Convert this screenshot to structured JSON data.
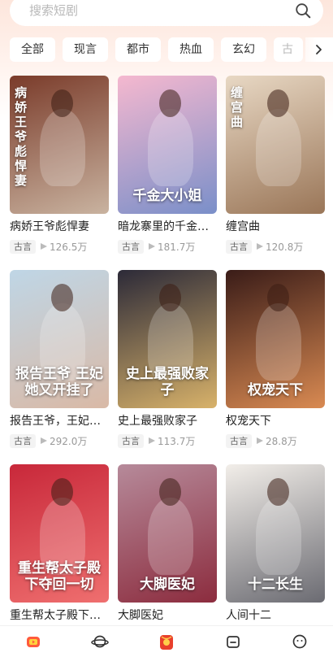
{
  "search": {
    "placeholder": "搜索短剧",
    "icon": "search-icon"
  },
  "categories": [
    {
      "label": "全部",
      "active": true
    },
    {
      "label": "现言"
    },
    {
      "label": "都市"
    },
    {
      "label": "热血"
    },
    {
      "label": "玄幻"
    },
    {
      "label": "古"
    }
  ],
  "more_icon": "chevron-right-icon",
  "dramas": [
    {
      "title": "病娇王爷彪悍妻",
      "cover_text": "病娇王爷彪悍妻",
      "tag": "古言",
      "plays": "126.5万",
      "colors": [
        "#7a3b2a",
        "#c9b3a0"
      ]
    },
    {
      "title": "暗龙寨里的千金大小姐",
      "cover_text": "千金大小姐",
      "tag": "古言",
      "plays": "181.7万",
      "colors": [
        "#f5b8cf",
        "#7a8fc9"
      ]
    },
    {
      "title": "缠宫曲",
      "cover_text": "缠宫曲",
      "tag": "古言",
      "plays": "120.8万",
      "colors": [
        "#e8d8c4",
        "#9a7658"
      ]
    },
    {
      "title": "报告王爷，王妃她又开挂了",
      "cover_text": "报告王爷 王妃她又开挂了",
      "tag": "古言",
      "plays": "292.0万",
      "colors": [
        "#bfd6e6",
        "#d9b9a6"
      ]
    },
    {
      "title": "史上最强败家子",
      "cover_text": "史上最强败家子",
      "tag": "古言",
      "plays": "113.7万",
      "colors": [
        "#2c2a38",
        "#d8b26a"
      ]
    },
    {
      "title": "权宠天下",
      "cover_text": "权宠天下",
      "tag": "古言",
      "plays": "28.8万",
      "colors": [
        "#3a1c18",
        "#d98a52"
      ]
    },
    {
      "title": "重生帮太子殿下夺回一切",
      "cover_text": "重生帮太子殿下夺回一切",
      "tag": "",
      "plays": "",
      "colors": [
        "#c8283a",
        "#ef6f6f"
      ]
    },
    {
      "title": "大脚医妃",
      "cover_text": "大脚医妃",
      "tag": "",
      "plays": "",
      "colors": [
        "#b68a9a",
        "#8c2c3e"
      ]
    },
    {
      "title": "人间十二",
      "cover_text": "十二长生",
      "tag": "",
      "plays": "",
      "colors": [
        "#f2eee9",
        "#6b6b72"
      ]
    }
  ],
  "tabbar": [
    {
      "name": "tab-drama",
      "icon": "drama-icon"
    },
    {
      "name": "tab-community",
      "icon": "planet-icon"
    },
    {
      "name": "tab-bonus",
      "icon": "red-envelope-icon"
    },
    {
      "name": "tab-history",
      "icon": "folder-icon"
    },
    {
      "name": "tab-profile",
      "icon": "smile-icon"
    }
  ],
  "colors": {
    "accent": "#ff5a3c",
    "text": "#222222",
    "muted": "#999999"
  }
}
